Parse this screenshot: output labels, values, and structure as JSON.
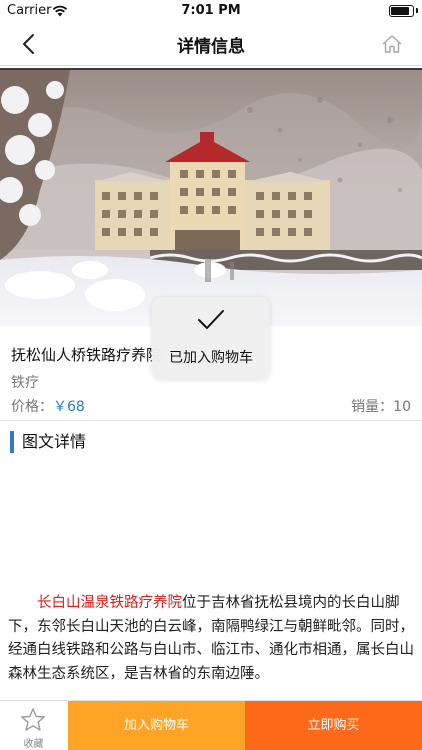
{
  "status_bar": {
    "carrier": "Carrier",
    "time": "7:01 PM",
    "battery_level": 0.9
  },
  "nav": {
    "title": "详情信息",
    "back_icon": "chevron-left-icon",
    "home_icon": "home-icon"
  },
  "product": {
    "name": "抚松仙人桥铁路疗养院",
    "category": "铁疗",
    "price_label": "价格：",
    "price_value": "￥68",
    "sales_label": "销量：",
    "sales_value": "10"
  },
  "section": {
    "title": "图文详情"
  },
  "article": {
    "highlight": "长白山温泉铁路疗养院",
    "body": "位于吉林省抚松县境内的长白山脚下，东邻长白山天池的白云峰，南隔鸭绿江与朝鲜毗邻。同时，经通白线铁路和公路与白山市、临江市、通化市相通，属长白山森林生态系统区，是吉林省的东南边陲。"
  },
  "toast": {
    "icon": "checkmark-icon",
    "message": "已加入购物车"
  },
  "bottom_bar": {
    "favorite_label": "收藏",
    "favorite_icon": "star-icon",
    "add_to_cart_label": "加入购物车",
    "buy_now_label": "立即购买"
  },
  "colors": {
    "accent_blue": "#3478c6",
    "price_blue": "#2f7fc4",
    "highlight_red": "#e02020",
    "add_cart_orange": "#ffa426",
    "buy_now_orange": "#ff6a1a"
  }
}
